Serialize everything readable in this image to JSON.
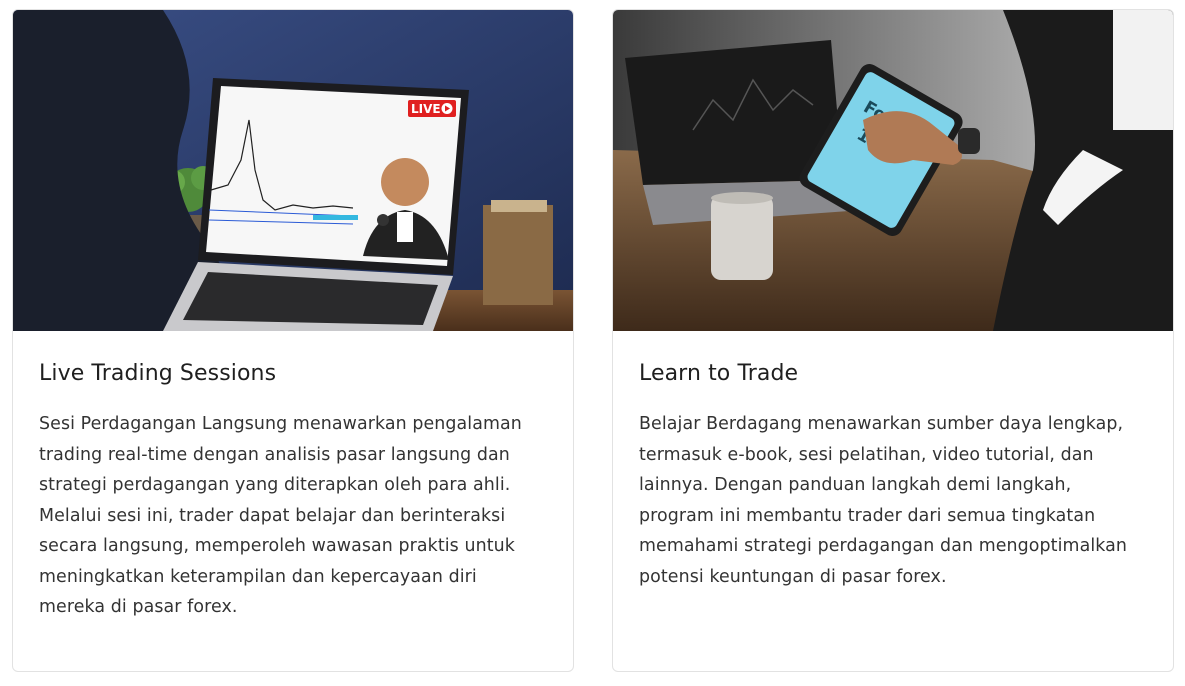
{
  "cards": [
    {
      "image": {
        "description_icon": "live-trading-photo",
        "badge": "LIVE"
      },
      "title": "Live Trading Sessions",
      "text": "Sesi Perdagangan Langsung menawarkan pengalaman trading real-time dengan analisis pasar langsung dan strategi perdagangan yang diterapkan oleh para ahli. Melalui sesi ini, trader dapat belajar dan berinteraksi secara langsung, memperoleh wawasan praktis untuk meningkatkan keterampilan dan kepercayaan diri mereka di pasar forex."
    },
    {
      "image": {
        "description_icon": "learn-trade-photo",
        "tablet_line1": "Forex",
        "tablet_line2": "101"
      },
      "title": "Learn to Trade",
      "text": "Belajar Berdagang menawarkan sumber daya lengkap, termasuk e-book, sesi pelatihan, video tutorial, dan lainnya. Dengan panduan langkah demi langkah, program ini membantu trader dari semua tingkatan memahami strategi perdagangan dan mengoptimalkan potensi keuntungan di pasar forex."
    }
  ],
  "colors": {
    "live_red": "#e02020",
    "tablet_blue": "#7fd3ea",
    "wall_blue": "#2d3e6e",
    "wood": "#6b4a2e"
  }
}
